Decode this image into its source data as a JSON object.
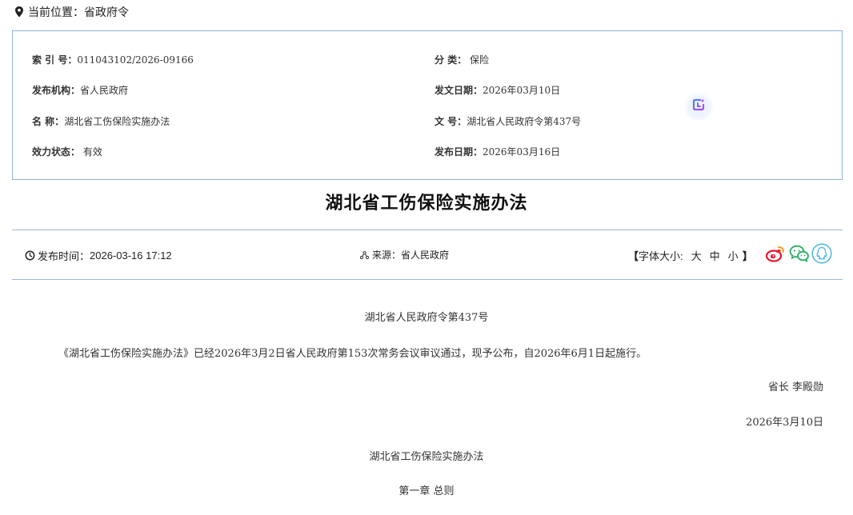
{
  "breadcrumb": {
    "label": "当前位置：",
    "current": "省政府令"
  },
  "info": {
    "index_key": "索 引 号：",
    "index_val": "011043102/2026-09166",
    "category_key": "分 类：",
    "category_val": "保险",
    "publisher_key": "发布机构：",
    "publisher_val": "省人民政府",
    "doc_date_key": "发文日期：",
    "doc_date_val": "2026年03月10日",
    "name_key": "名 称：",
    "name_val": "湖北省工伤保险实施办法",
    "doc_no_key": "文 号：",
    "doc_no_val": "湖北省人民政府令第437号",
    "status_key": "效力状态：",
    "status_val": "有效",
    "pub_date_key": "发布日期：",
    "pub_date_val": "2026年03月16日"
  },
  "article": {
    "title": "湖北省工伤保险实施办法",
    "publish_time_label": "发布时间：",
    "publish_time": "2026-03-16 17:12",
    "source_label": "来源：",
    "source": "省人民政府",
    "font_size_open": "【",
    "font_size_label": "字体大小:",
    "font_large": "大",
    "font_medium": "中",
    "font_small": "小",
    "font_size_close": "】"
  },
  "content": {
    "order_no": "湖北省人民政府令第437号",
    "paragraph": "《湖北省工伤保险实施办法》已经2026年3月2日省人民政府第153次常务会议审议通过，现予公布，自2026年6月1日起施行。",
    "signature": "省长  李殿勋",
    "date": "2026年3月10日",
    "doc_title": "湖北省工伤保险实施办法",
    "chapter": "第一章  总则"
  },
  "icons": {
    "location": "map-pin-icon",
    "clock": "clock-icon",
    "source": "source-icon",
    "weibo": "weibo-icon",
    "wechat": "wechat-icon",
    "qq": "qq-icon",
    "ai_assistant": "ai-assistant-icon"
  },
  "colors": {
    "border": "#8fb0d6",
    "weibo": "#e6162d",
    "wechat": "#2aae67",
    "qq": "#4bb4e6",
    "ai_accent": "#6c5ce7"
  }
}
